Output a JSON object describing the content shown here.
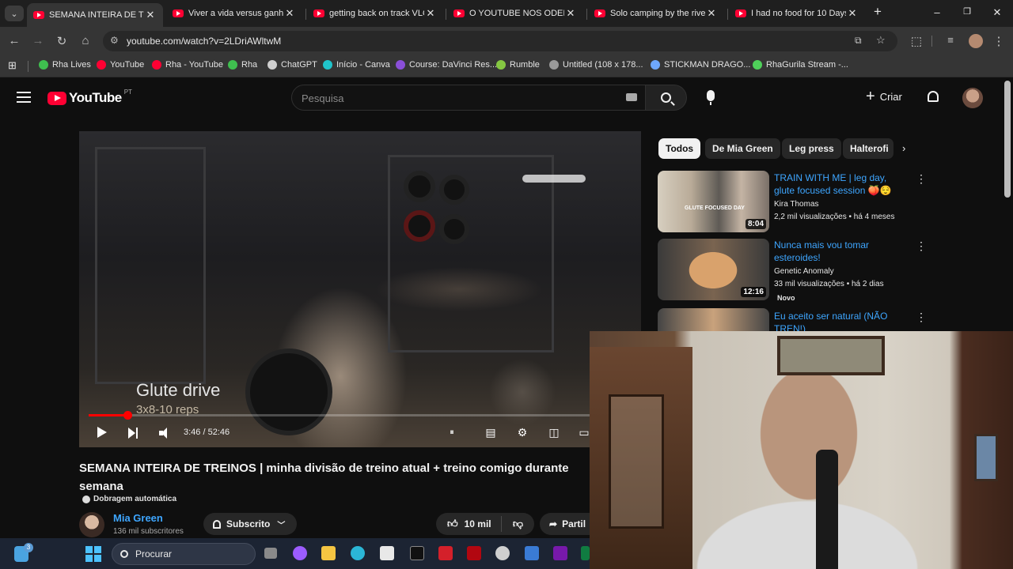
{
  "browser": {
    "tabs": [
      {
        "title": "SEMANA INTEIRA DE TREI",
        "active": true
      },
      {
        "title": "Viver a vida versus ganhar",
        "active": false
      },
      {
        "title": "getting back on track VLO",
        "active": false
      },
      {
        "title": "O YOUTUBE NOS ODEIA -",
        "active": false
      },
      {
        "title": "Solo camping by the river",
        "active": false
      },
      {
        "title": "I had no food for 10 Days",
        "active": false
      }
    ],
    "new_tab_label": "+",
    "url": "youtube.com/watch?v=2LDriAWltwM",
    "bookmarks": [
      {
        "label": "Rha Lives",
        "color": "#3fbf4f"
      },
      {
        "label": "YouTube",
        "color": "#ff0033"
      },
      {
        "label": "Rha - YouTube",
        "color": "#ff0033"
      },
      {
        "label": "Rha",
        "color": "#3fbf4f"
      },
      {
        "label": "ChatGPT",
        "color": "#cfcfcf"
      },
      {
        "label": "Início - Canva",
        "color": "#20c4cb"
      },
      {
        "label": "Course: DaVinci Res...",
        "color": "#8a4fd8"
      },
      {
        "label": "Rumble",
        "color": "#85c742"
      },
      {
        "label": "Untitled (108 x 178...",
        "color": "#9a9a9a"
      },
      {
        "label": "STICKMAN DRAGO...",
        "color": "#6ea8ff"
      },
      {
        "label": "RhaGurila Stream -...",
        "color": "#4fd15a"
      }
    ]
  },
  "youtube": {
    "logo_text": "YouTube",
    "country_code": "PT",
    "search_placeholder": "Pesquisa",
    "create_label": "Criar",
    "video": {
      "overlay_title": "Glute drive",
      "overlay_sub": "3x8-10 reps",
      "time": "3:46 / 52:46",
      "progress_fraction": 0.0714
    },
    "title": "SEMANA INTEIRA DE TREINOS | minha divisão de treino atual + treino comigo durante semana",
    "dubbing": "Dobragem automática",
    "channel": {
      "name": "Mia Green",
      "subs": "136 mil subscritores"
    },
    "subscribe_label": "Subscrito",
    "like_count": "10 mil",
    "share_label": "Partil",
    "chips": [
      "Todos",
      "De Mia Green",
      "Leg press",
      "Halterofi"
    ],
    "related": [
      {
        "title": "TRAIN WITH ME | leg day, glute focused session 🍑😌",
        "channel": "Kira Thomas",
        "meta": "2,2 mil visualizações • há 4 meses",
        "duration": "8:04",
        "thumb_text": "GLUTE FOCUSED DAY",
        "badge": ""
      },
      {
        "title": "Nunca mais vou tomar esteroides!",
        "channel": "Genetic Anomaly",
        "meta": "33 mil visualizações • há 2 dias",
        "duration": "12:16",
        "thumb_text": "",
        "badge": "Novo"
      },
      {
        "title": "Eu aceito ser natural (NÃO TREN!)",
        "channel": "",
        "meta": "",
        "duration": "",
        "thumb_text": "",
        "badge": ""
      }
    ]
  },
  "taskbar": {
    "search_label": "Procurar",
    "weather_badge": "3",
    "apps": [
      {
        "name": "copilot",
        "color": "#9c5cff"
      },
      {
        "name": "explorer",
        "color": "#f5c542"
      },
      {
        "name": "edge",
        "color": "#2bb6d6"
      },
      {
        "name": "store",
        "color": "#e8e8e8"
      },
      {
        "name": "capcut",
        "color": "#111111"
      },
      {
        "name": "shield",
        "color": "#d4202a"
      },
      {
        "name": "netflix",
        "color": "#b20710"
      },
      {
        "name": "settings",
        "color": "#cfcfcf"
      },
      {
        "name": "calculator",
        "color": "#3a7bd5"
      },
      {
        "name": "onenote",
        "color": "#7719aa"
      },
      {
        "name": "excel",
        "color": "#107c41"
      }
    ]
  }
}
